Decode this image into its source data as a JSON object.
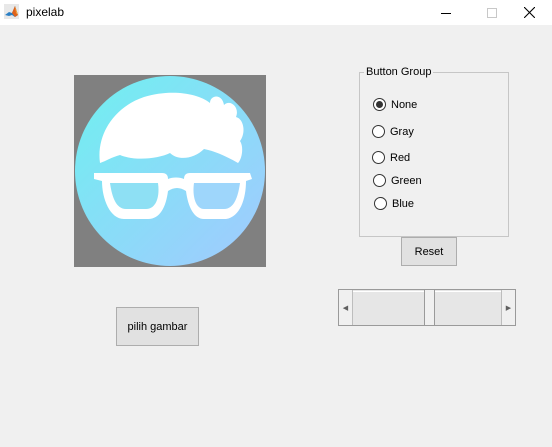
{
  "window": {
    "title": "pixelab",
    "icon": "matlab-icon"
  },
  "buttons": {
    "load_image": "pilih gambar",
    "reset": "Reset"
  },
  "button_group": {
    "title": "Button Group",
    "options": [
      {
        "label": "None",
        "checked": true
      },
      {
        "label": "Gray",
        "checked": false
      },
      {
        "label": "Red",
        "checked": false
      },
      {
        "label": "Green",
        "checked": false
      },
      {
        "label": "Blue",
        "checked": false
      }
    ]
  },
  "image": {
    "background": "#808080",
    "circle_color_start": "#6ff0f0",
    "circle_color_end": "#a3c9ff"
  }
}
